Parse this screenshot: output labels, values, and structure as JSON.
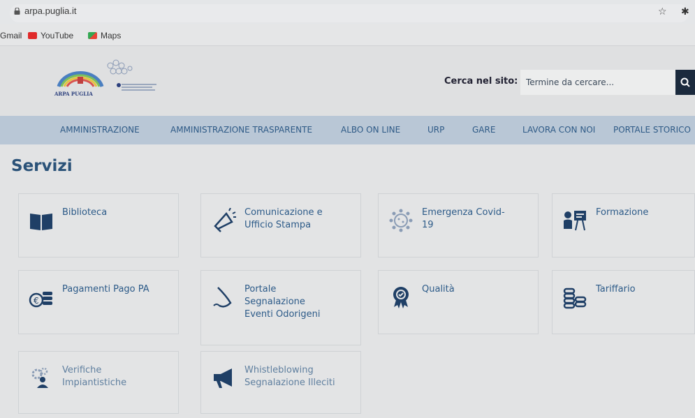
{
  "browser": {
    "url": "arpa.puglia.it",
    "bookmarks": [
      "Gmail",
      "YouTube",
      "Maps"
    ]
  },
  "header": {
    "logo_text": "ARPA PUGLIA",
    "search_label": "Cerca nel sito:",
    "search_placeholder": "Termine da cercare..."
  },
  "nav": {
    "items": [
      "AMMINISTRAZIONE",
      "AMMINISTRAZIONE TRASPARENTE",
      "ALBO ON LINE",
      "URP",
      "GARE",
      "LAVORA CON NOI",
      "PORTALE STORICO"
    ]
  },
  "page": {
    "title": "Servizi"
  },
  "services": [
    {
      "line1": "Biblioteca",
      "line2": "",
      "line3": "",
      "icon": "book-icon"
    },
    {
      "line1": "Comunicazione e",
      "line2": "Ufficio Stampa",
      "line3": "",
      "icon": "megaphone-icon"
    },
    {
      "line1": "Emergenza Covid-",
      "line2": "19",
      "line3": "",
      "icon": "virus-icon"
    },
    {
      "line1": "Formazione",
      "line2": "",
      "line3": "",
      "icon": "teacher-icon"
    },
    {
      "line1": "Pagamenti Pago PA",
      "line2": "",
      "line3": "",
      "icon": "coins-icon"
    },
    {
      "line1": "Portale",
      "line2": "Segnalazione",
      "line3": "Eventi Odorigeni",
      "icon": "nose-icon"
    },
    {
      "line1": "Qualità",
      "line2": "",
      "line3": "",
      "icon": "quality-badge-icon"
    },
    {
      "line1": "Tariffario",
      "line2": "",
      "line3": "",
      "icon": "stacked-coins-icon"
    },
    {
      "line1": "Verifiche",
      "line2": "Impiantistiche",
      "line3": "",
      "icon": "gears-worker-icon"
    },
    {
      "line1": "Whistleblowing",
      "line2": "Segnalazione Illeciti",
      "line3": "",
      "icon": "loudspeaker-icon"
    }
  ],
  "colors": {
    "nav_bg": "#b9c7d6",
    "link": "#2c5a88",
    "title": "#2a5278",
    "search_button": "#1b2a3d"
  }
}
